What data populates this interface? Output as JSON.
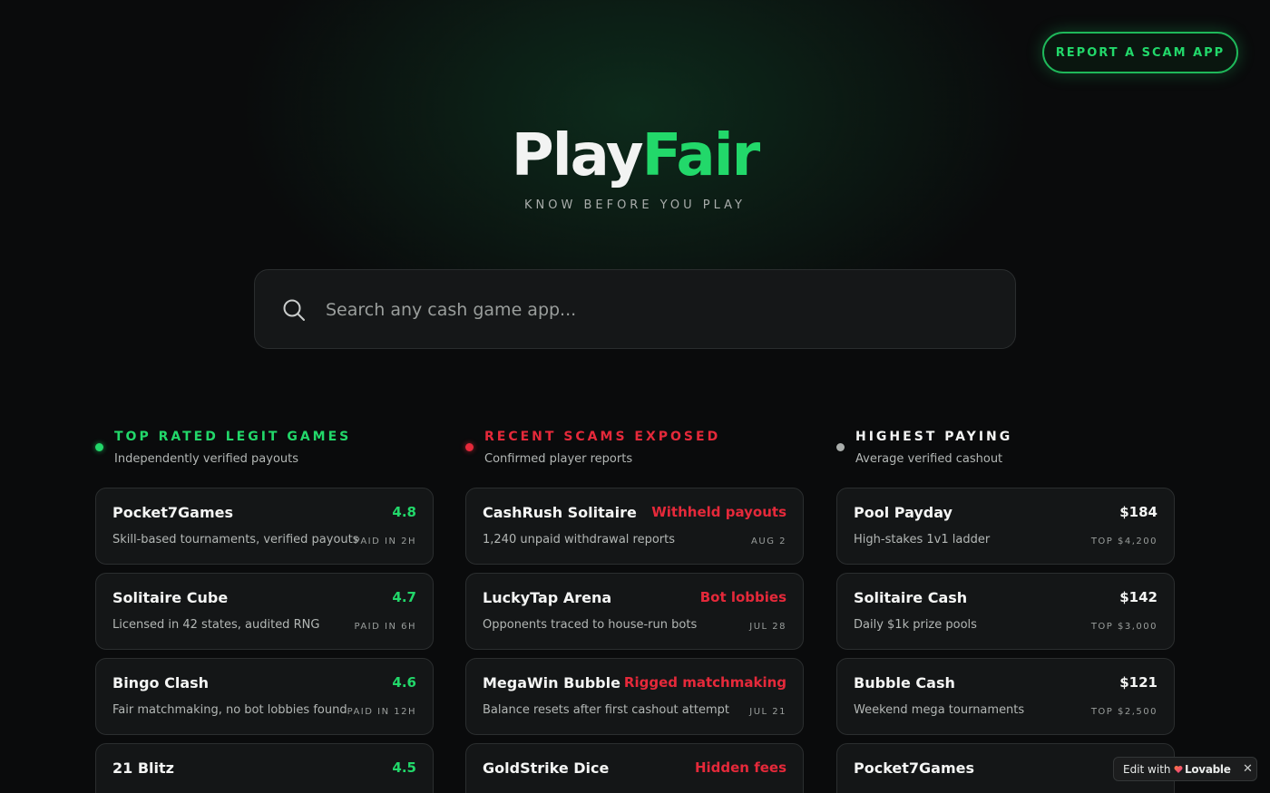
{
  "header": {
    "report_button": "REPORT A SCAM APP",
    "logo_part1": "Play",
    "logo_part2": "Fair",
    "tagline": "KNOW BEFORE YOU PLAY"
  },
  "search": {
    "placeholder": "Search any cash game app...",
    "icon": "search-icon"
  },
  "colors": {
    "accent_green": "#22d86a",
    "accent_red": "#e5293a",
    "neutral": "#a9adab",
    "background": "#0a0b0c",
    "card": "#141617"
  },
  "columns": [
    {
      "title": "TOP RATED LEGIT GAMES",
      "subtitle": "Independently verified payouts",
      "dot_color": "#22d86a",
      "cards": [
        {
          "name": "Pocket7Games",
          "right": "4.8",
          "desc": "Skill-based tournaments, verified payouts",
          "meta": "PAID IN 2H"
        },
        {
          "name": "Solitaire Cube",
          "right": "4.7",
          "desc": "Licensed in 42 states, audited RNG",
          "meta": "PAID IN 6H"
        },
        {
          "name": "Bingo Clash",
          "right": "4.6",
          "desc": "Fair matchmaking, no bot lobbies found",
          "meta": "PAID IN 12H"
        },
        {
          "name": "21 Blitz",
          "right": "4.5",
          "desc": "",
          "meta": ""
        }
      ]
    },
    {
      "title": "RECENT SCAMS EXPOSED",
      "subtitle": "Confirmed player reports",
      "dot_color": "#e5293a",
      "cards": [
        {
          "name": "CashRush Solitaire",
          "right": "Withheld payouts",
          "desc": "1,240 unpaid withdrawal reports",
          "meta": "AUG 2"
        },
        {
          "name": "LuckyTap Arena",
          "right": "Bot lobbies",
          "desc": "Opponents traced to house-run bots",
          "meta": "JUL 28"
        },
        {
          "name": "MegaWin Bubble",
          "right": "Rigged matchmaking",
          "desc": "Balance resets after first cashout attempt",
          "meta": "JUL 21"
        },
        {
          "name": "GoldStrike Dice",
          "right": "Hidden fees",
          "desc": "",
          "meta": ""
        }
      ]
    },
    {
      "title": "HIGHEST PAYING",
      "subtitle": "Average verified cashout",
      "dot_color": "#a9adab",
      "cards": [
        {
          "name": "Pool Payday",
          "right": "$184",
          "desc": "High-stakes 1v1 ladder",
          "meta": "TOP $4,200"
        },
        {
          "name": "Solitaire Cash",
          "right": "$142",
          "desc": "Daily $1k prize pools",
          "meta": "TOP $3,000"
        },
        {
          "name": "Bubble Cash",
          "right": "$121",
          "desc": "Weekend mega tournaments",
          "meta": "TOP $2,500"
        },
        {
          "name": "Pocket7Games",
          "right": "",
          "desc": "",
          "meta": ""
        }
      ]
    }
  ],
  "badge": {
    "edit_label": "Edit with",
    "brand_label": "Lovable",
    "close_label": "✕"
  }
}
